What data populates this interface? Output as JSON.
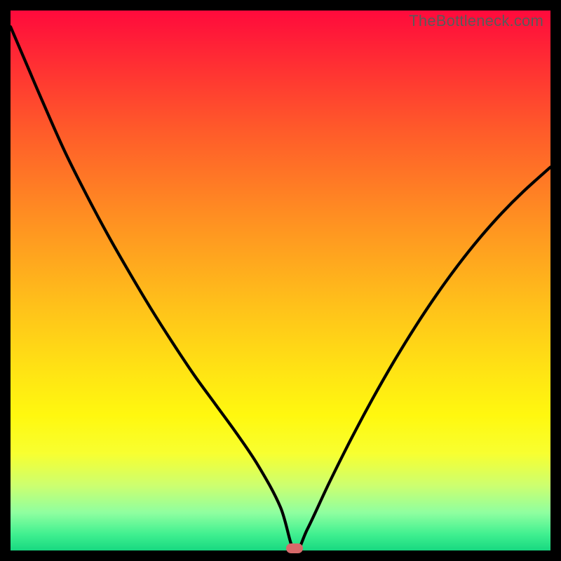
{
  "watermark": "TheBottleneck.com",
  "chart_data": {
    "type": "line",
    "title": "",
    "xlabel": "",
    "ylabel": "",
    "xlim": [
      0,
      100
    ],
    "ylim": [
      0,
      100
    ],
    "grid": false,
    "legend": false,
    "annotations": [],
    "marker": {
      "x": 52.6,
      "y": 0,
      "color": "#d76a6a"
    },
    "x": [
      0,
      3,
      6,
      10,
      14,
      18,
      22,
      26,
      30,
      34,
      38,
      42,
      46,
      50,
      52.6,
      55,
      59,
      63,
      67,
      71,
      75,
      79,
      83,
      87,
      91,
      95,
      100
    ],
    "y": [
      97,
      90,
      83,
      74,
      66,
      58.5,
      51.5,
      44.8,
      38.5,
      32.5,
      27,
      21.5,
      15.5,
      8,
      0,
      4,
      12.5,
      20.5,
      28,
      35,
      41.5,
      47.5,
      53,
      58,
      62.5,
      66.5,
      71
    ],
    "series": [
      {
        "name": "bottleneck-curve",
        "x_ref": "x",
        "y_ref": "y"
      }
    ]
  },
  "colors": {
    "background": "#000000",
    "curve": "#000000",
    "marker": "#d76a6a"
  }
}
